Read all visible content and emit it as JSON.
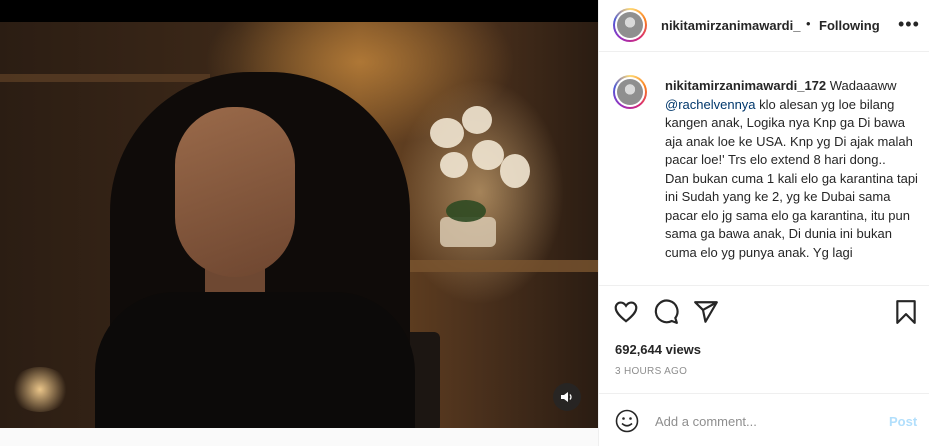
{
  "post": {
    "author": "nikitamirzanimawardi_",
    "separator": "•",
    "follow_status": "Following",
    "more": "•••"
  },
  "caption": {
    "author": "nikitamirzanimawardi_172",
    "lead": "Wadaaaww",
    "mention": "@rachelvennya",
    "text1": "klo alesan yg loe bilang kangen anak, Logika nya Knp ga Di bawa aja anak loe ke USA. Knp yg Di ajak malah pacar loe!' Trs elo extend 8 hari dong..",
    "text2": "Dan bukan cuma 1 kali elo ga karantina tapi ini Sudah yang ke 2, yg ke Dubai sama pacar elo jg sama elo ga karantina, itu pun sama ga bawa anak, Di dunia ini bukan cuma elo yg punya anak. Yg lagi"
  },
  "stats": {
    "views": "692,644 views",
    "time": "3 HOURS AGO"
  },
  "comment_box": {
    "placeholder": "Add a comment...",
    "post_label": "Post"
  },
  "icons": {
    "like": "heart-icon",
    "comment": "comment-icon",
    "share": "share-icon",
    "save": "bookmark-icon",
    "emoji": "emoji-icon",
    "volume": "volume-icon"
  },
  "colors": {
    "text": "#262626",
    "muted": "#8e8e8e",
    "link": "#00376b",
    "post_disabled": "#b2dffc",
    "border": "#efefef"
  }
}
